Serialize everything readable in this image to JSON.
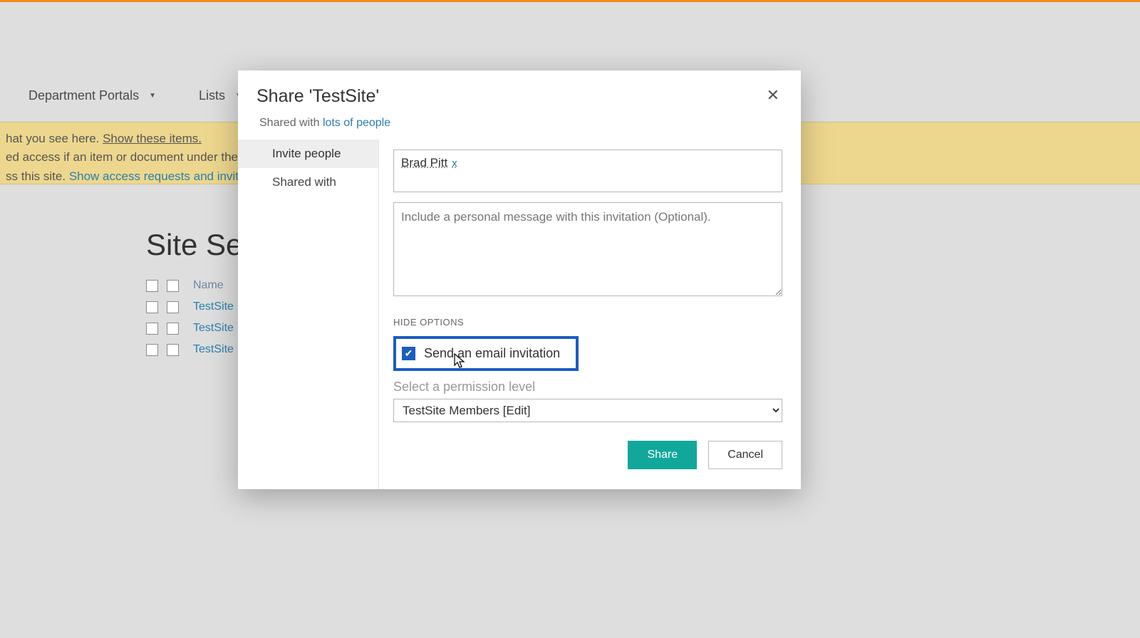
{
  "accent_color": "#f38b17",
  "nav": {
    "items": [
      "Department Portals",
      "Lists"
    ]
  },
  "banner": {
    "line1_prefix": "hat you see here.  ",
    "line1_link": "Show these items.",
    "line2": "ed access if an item or document under the site",
    "line3_prefix": "ss this site. ",
    "line3_link": "Show access requests and invitation"
  },
  "page": {
    "title": "Site Sett",
    "header_col": "Name",
    "rows": [
      "TestSite",
      "TestSite",
      "TestSite"
    ]
  },
  "dialog": {
    "title": "Share 'TestSite'",
    "shared_prefix": "Shared with ",
    "shared_link": "lots of people",
    "tabs": {
      "invite": "Invite people",
      "shared": "Shared with"
    },
    "people_chip": "Brad Pitt",
    "chip_x": "x",
    "message_placeholder": "Include a personal message with this invitation (Optional).",
    "options_toggle": "HIDE OPTIONS",
    "email_checkbox_label": "Send an email invitation",
    "email_checked": true,
    "permission_label": "Select a permission level",
    "permission_value": "TestSite Members [Edit]",
    "share_btn": "Share",
    "cancel_btn": "Cancel",
    "close_x": "✕"
  }
}
